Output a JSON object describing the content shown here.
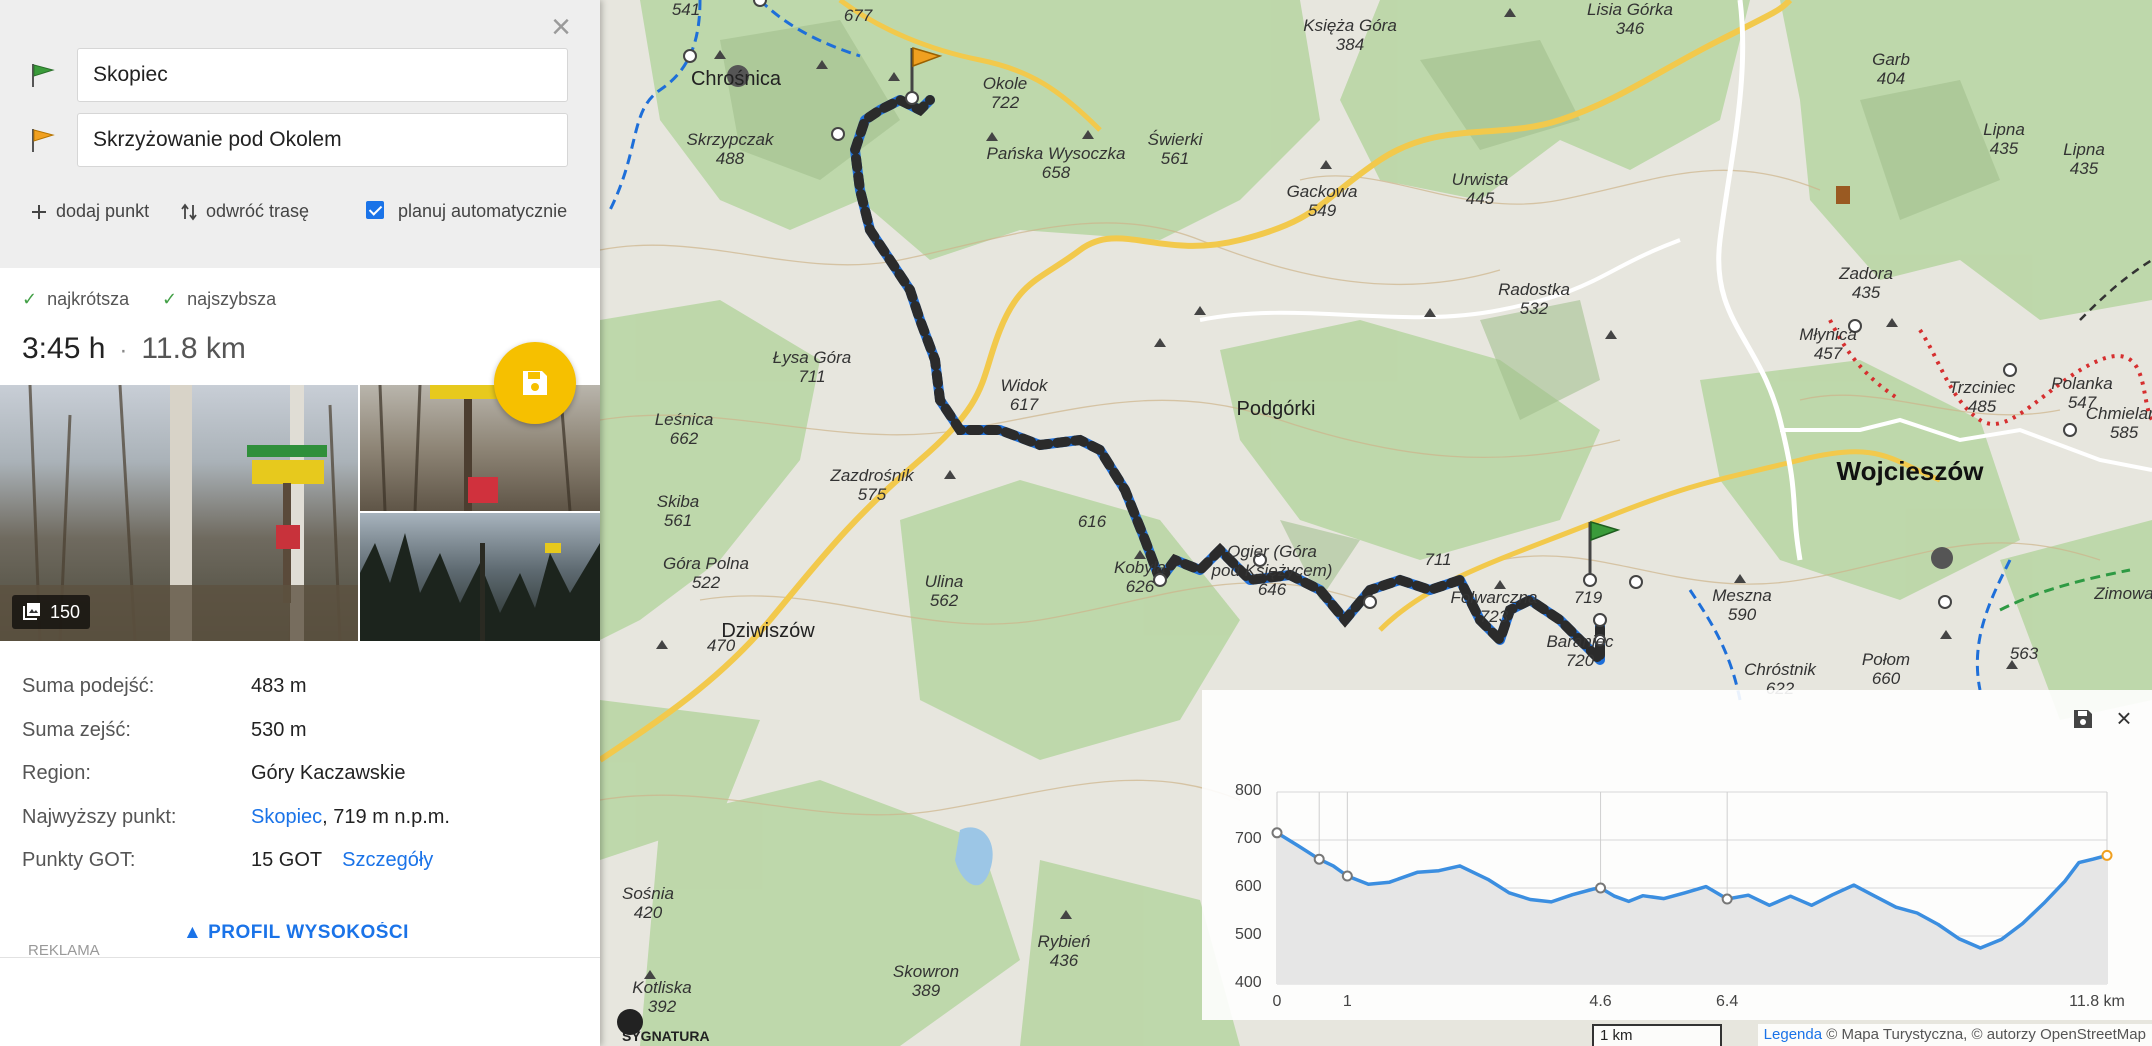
{
  "route": {
    "start": "Skopiec",
    "end": "Skrzyżowanie pod Okolem",
    "add_point": "dodaj punkt",
    "reverse": "odwróć trasę",
    "auto_plan": "planuj automatycznie",
    "auto_plan_checked": true,
    "option_shortest": "najkrótsza",
    "option_fastest": "najszybsza",
    "time": "3:45 h",
    "separator": "·",
    "distance": "11.8 km",
    "photo_count": "150"
  },
  "details": {
    "ascent_label": "Suma podejść:",
    "ascent_value": "483 m",
    "descent_label": "Suma zejść:",
    "descent_value": "530 m",
    "region_label": "Region:",
    "region_value": "Góry Kaczawskie",
    "highest_label": "Najwyższy punkt:",
    "highest_link": "Skopiec",
    "highest_value": ", 719 m n.p.m.",
    "got_label": "Punkty GOT:",
    "got_value": "15 GOT",
    "got_link": "Szczegóły",
    "profile_link": "PROFIL WYSOKOŚCI",
    "ad_label": "REKLAMA"
  },
  "map": {
    "labels": [
      {
        "text": "541",
        "kind": "peak"
      },
      {
        "text": "677",
        "kind": "peak"
      },
      {
        "text": "Chrośnica",
        "kind": "town"
      },
      {
        "text": "Skrzypczak\n488",
        "kind": "peak"
      },
      {
        "text": "Okole\n722",
        "kind": "peak"
      },
      {
        "text": "Pańska Wysoczka\n658",
        "kind": "peak"
      },
      {
        "text": "Świerki\n561",
        "kind": "peak"
      },
      {
        "text": "Księża Góra\n384",
        "kind": "peak"
      },
      {
        "text": "Lisia Górka\n346",
        "kind": "peak"
      },
      {
        "text": "Garb\n404",
        "kind": "peak"
      },
      {
        "text": "Lipna\n435",
        "kind": "peak"
      },
      {
        "text": "Lipna\n435",
        "kind": "peak"
      },
      {
        "text": "Gackowa\n549",
        "kind": "peak"
      },
      {
        "text": "Urwista\n445",
        "kind": "peak"
      },
      {
        "text": "Radostka\n532",
        "kind": "peak"
      },
      {
        "text": "Zadora\n435",
        "kind": "peak"
      },
      {
        "text": "Młynica\n457",
        "kind": "peak"
      },
      {
        "text": "Łysa Góra\n711",
        "kind": "peak"
      },
      {
        "text": "Widok\n617",
        "kind": "peak"
      },
      {
        "text": "Podgórki",
        "kind": "town"
      },
      {
        "text": "Trzciniec\n485",
        "kind": "peak"
      },
      {
        "text": "Polanka\n547",
        "kind": "peak"
      },
      {
        "text": "Chmielarz\n585",
        "kind": "peak"
      },
      {
        "text": "Leśnica\n662",
        "kind": "peak"
      },
      {
        "text": "Zazdrośnik\n575",
        "kind": "peak"
      },
      {
        "text": "Wojcieszów",
        "kind": "big"
      },
      {
        "text": "Skiba\n561",
        "kind": "peak"
      },
      {
        "text": "616",
        "kind": "peak"
      },
      {
        "text": "Kobyła\n626",
        "kind": "peak"
      },
      {
        "text": "Ogier (Góra\npod Księżycem)\n646",
        "kind": "peak"
      },
      {
        "text": "711",
        "kind": "peak"
      },
      {
        "text": "Góra Polna\n522",
        "kind": "peak"
      },
      {
        "text": "Ulina\n562",
        "kind": "peak"
      },
      {
        "text": "Folwarczna\n723",
        "kind": "peak"
      },
      {
        "text": "719",
        "kind": "peak"
      },
      {
        "text": "Meszna\n590",
        "kind": "peak"
      },
      {
        "text": "Zimowa",
        "kind": "peak"
      },
      {
        "text": "Dziwiszów",
        "kind": "town"
      },
      {
        "text": "470",
        "kind": "peak"
      },
      {
        "text": "Baraniec\n720",
        "kind": "peak"
      },
      {
        "text": "Chróstnik\n622",
        "kind": "peak"
      },
      {
        "text": "Połom\n660",
        "kind": "peak"
      },
      {
        "text": "563",
        "kind": "peak"
      },
      {
        "text": "Sośnia\n420",
        "kind": "peak"
      },
      {
        "text": "Rybień\n436",
        "kind": "peak"
      },
      {
        "text": "Skowron\n389",
        "kind": "peak"
      },
      {
        "text": "Kotliska\n392",
        "kind": "peak"
      }
    ],
    "sygnatura": "SYGNATURA",
    "scale_label": "1 km",
    "legend_link": "Legenda",
    "attribution": "© Mapa Turystyczna, © autorzy OpenStreetMap"
  },
  "chart_data": {
    "type": "area",
    "title": "",
    "xlabel": "",
    "ylabel": "",
    "x_unit": "km",
    "ylim": [
      400,
      800
    ],
    "xlim": [
      0,
      11.8
    ],
    "y_ticks": [
      "800",
      "700",
      "600",
      "500",
      "400"
    ],
    "x_ticks": [
      "0",
      "1",
      "4.6",
      "6.4",
      "11.8 km"
    ],
    "x_tick_values": [
      0,
      1,
      4.6,
      6.4,
      11.8
    ],
    "series": [
      {
        "x": [
          0,
          0.3,
          0.6,
          0.8,
          1.0,
          1.3,
          1.6,
          2.0,
          2.3,
          2.6,
          3.0,
          3.3,
          3.6,
          3.9,
          4.2,
          4.5,
          4.6,
          4.8,
          5.0,
          5.2,
          5.5,
          5.8,
          6.1,
          6.4,
          6.7,
          7.0,
          7.3,
          7.6,
          7.9,
          8.2,
          8.5,
          8.8,
          9.1,
          9.4,
          9.7,
          10.0,
          10.3,
          10.6,
          10.9,
          11.2,
          11.4,
          11.6,
          11.8
        ],
        "y": [
          715,
          688,
          660,
          646,
          625,
          608,
          612,
          633,
          636,
          646,
          618,
          590,
          576,
          571,
          586,
          598,
          600,
          583,
          572,
          584,
          578,
          590,
          603,
          577,
          585,
          564,
          583,
          564,
          586,
          606,
          583,
          560,
          548,
          524,
          494,
          475,
          493,
          526,
          568,
          614,
          653,
          660,
          668
        ]
      }
    ],
    "markers_x": [
      0,
      0.6,
      1.0,
      4.6,
      6.4,
      11.8
    ]
  }
}
